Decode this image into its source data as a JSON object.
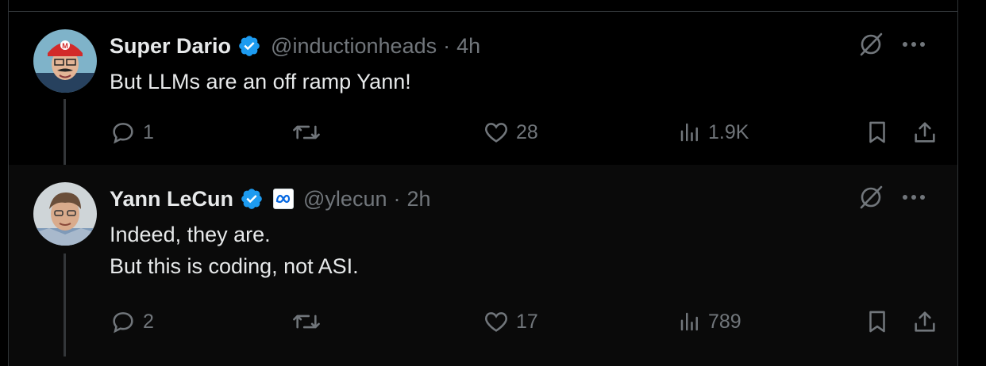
{
  "tweets": [
    {
      "name": "Super Dario",
      "handle": "@inductionheads",
      "separator": "·",
      "time": "4h",
      "text_lines": [
        "But LLMs are an off ramp Yann!"
      ],
      "replies": "1",
      "likes": "28",
      "views": "1.9K",
      "verified": true,
      "affiliate_badge": false
    },
    {
      "name": "Yann LeCun",
      "handle": "@ylecun",
      "separator": "·",
      "time": "2h",
      "text_lines": [
        "Indeed, they are.",
        "But this is coding, not ASI."
      ],
      "replies": "2",
      "likes": "17",
      "views": "789",
      "verified": true,
      "affiliate_badge": true
    }
  ],
  "colors": {
    "background": "#000000",
    "text": "#e7e9ea",
    "muted": "#71767b",
    "verified_blue": "#1d9bf0",
    "meta_blue": "#0668e1"
  },
  "icons": [
    "verified-badge-icon",
    "grok-icon",
    "more-icon",
    "reply-icon",
    "retweet-icon",
    "like-icon",
    "views-icon",
    "bookmark-icon",
    "share-icon",
    "meta-logo-icon"
  ]
}
